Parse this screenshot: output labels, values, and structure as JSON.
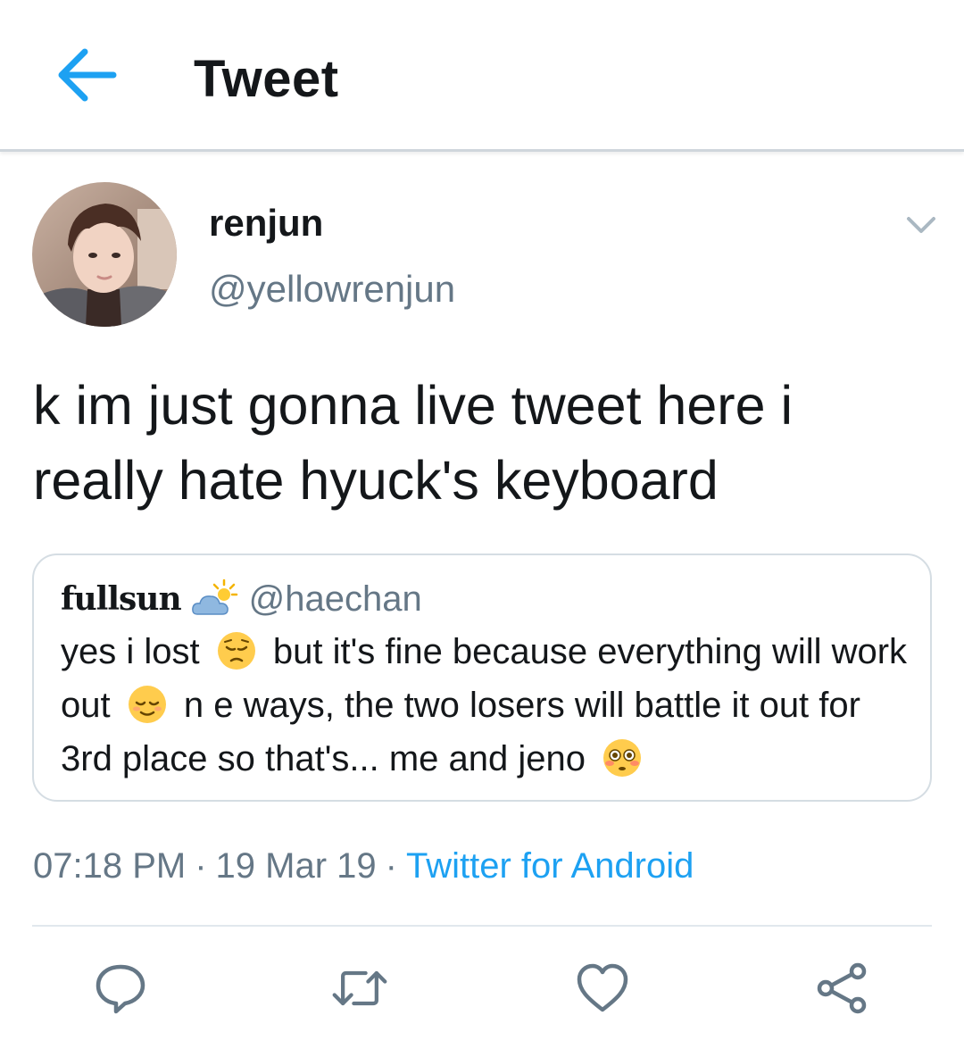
{
  "header": {
    "title": "Tweet"
  },
  "tweet": {
    "author": {
      "name": "renjun",
      "handle": "@yellowrenjun"
    },
    "text": "k im just gonna live tweet here i really hate hyuck's keyboard",
    "quoted": {
      "name": "fullsun",
      "handle": "@haechan",
      "segments": {
        "s1": "yes i lost",
        "s2": "but it's fine because everything will work out",
        "s3": "n e ways, the two losers will battle it out for 3rd place so that's... me and jeno"
      }
    },
    "meta": {
      "time": "07:18 PM",
      "sep1": "·",
      "date": "19 Mar 19",
      "sep2": "·",
      "source": "Twitter for Android"
    }
  },
  "icons": {
    "back": "arrow-left-icon",
    "caret": "chevron-down-icon",
    "reply": "reply-icon",
    "retweet": "retweet-icon",
    "like": "heart-icon",
    "share": "share-icon",
    "weather": "sun-behind-cloud-emoji",
    "pensive": "pensive-face-emoji",
    "relieved": "relieved-face-emoji",
    "flushed": "flushed-face-emoji"
  },
  "colors": {
    "accent": "#1da1f2",
    "text_primary": "#14171a",
    "text_secondary": "#657786",
    "border": "#d5dde3"
  }
}
